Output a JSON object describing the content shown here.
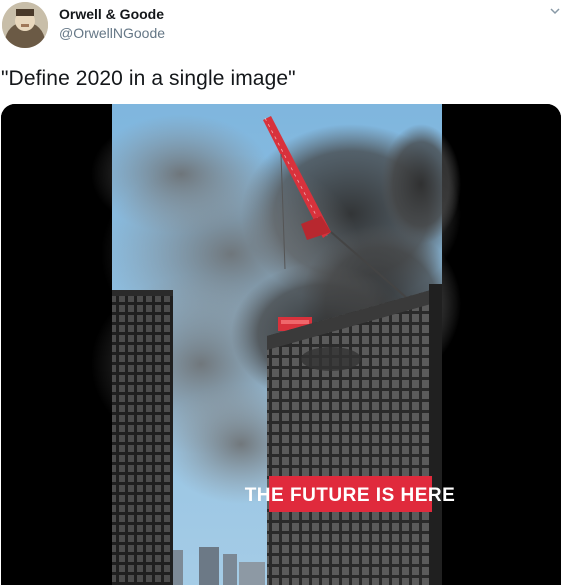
{
  "tweet": {
    "author": {
      "name": "Orwell & Goode",
      "handle": "@OrwellNGoode"
    },
    "text": "\"Define 2020 in a single image\"",
    "media": {
      "banner_text": "THE FUTURE IS HERE"
    }
  },
  "colors": {
    "banner": "#e02a3c",
    "crane": "#d8323c",
    "sky": "#8fc0e2"
  }
}
